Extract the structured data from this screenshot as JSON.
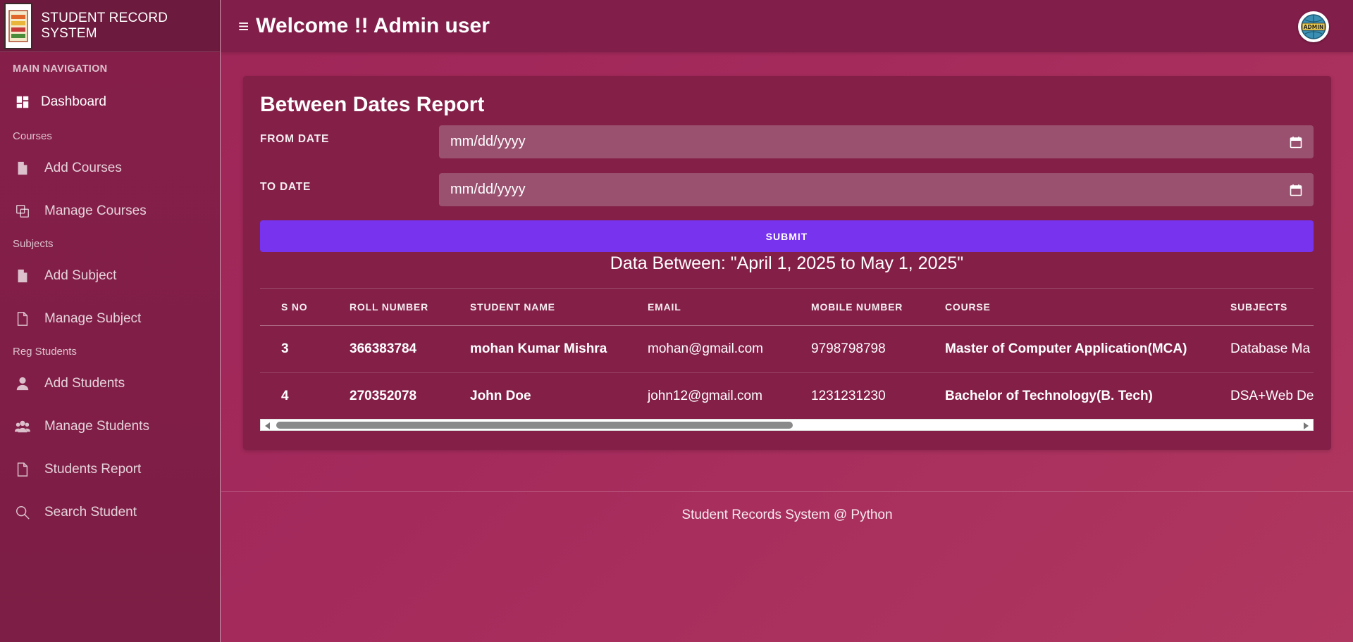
{
  "app": {
    "brand_name": "STUDENT RECORD SYSTEM"
  },
  "header": {
    "welcome": "Welcome !! Admin user",
    "avatar_text": "ADMIN"
  },
  "sidebar": {
    "main_heading": "MAIN NAVIGATION",
    "dashboard": "Dashboard",
    "courses_heading": "Courses",
    "add_courses": "Add Courses",
    "manage_courses": "Manage Courses",
    "subjects_heading": "Subjects",
    "add_subject": "Add Subject",
    "manage_subject": "Manage Subject",
    "reg_heading": "Reg Students",
    "add_students": "Add Students",
    "manage_students": "Manage Students",
    "students_report": "Students Report",
    "search_student": "Search Student"
  },
  "report": {
    "title": "Between Dates Report",
    "from_label": "FROM DATE",
    "from_value": "mm/dd/yyyy",
    "to_label": "TO DATE",
    "to_value": "mm/dd/yyyy",
    "submit_label": "SUBMIT",
    "range_text": "Data Between: \"April 1, 2025 to May 1, 2025\""
  },
  "table": {
    "headers": [
      "S NO",
      "ROLL NUMBER",
      "STUDENT NAME",
      "EMAIL",
      "MOBILE NUMBER",
      "COURSE",
      "SUBJECTS"
    ],
    "rows": [
      [
        "3",
        "366383784",
        "mohan Kumar Mishra",
        "mohan@gmail.com",
        "9798798798",
        "Master of Computer Application(MCA)",
        "Database Ma"
      ],
      [
        "4",
        "270352078",
        "John Doe",
        "john12@gmail.com",
        "1231231230",
        "Bachelor of Technology(B. Tech)",
        "DSA+Web De"
      ]
    ]
  },
  "footer": {
    "text": "Student Records System @ Python"
  },
  "colors": {
    "accent": "#7733ee",
    "sidebar": "#861f4a",
    "card": "#842048"
  }
}
